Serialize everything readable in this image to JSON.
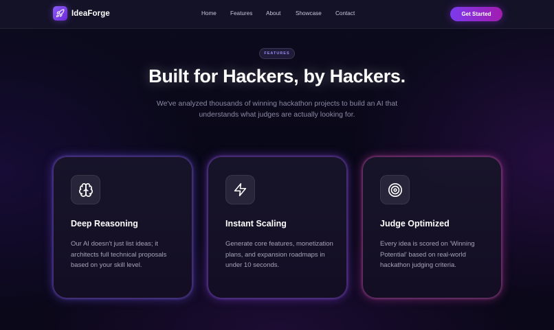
{
  "navbar": {
    "brand": "IdeaForge",
    "links": [
      "Home",
      "Features",
      "About",
      "Showcase",
      "Contact"
    ],
    "cta_label": "Get Started"
  },
  "hero": {
    "badge": "FEATURES",
    "title": "Built for Hackers, by Hackers.",
    "subtitle": "We've analyzed thousands of winning hackathon projects to build an AI that understands what judges are actually looking for."
  },
  "features": [
    {
      "icon": "brain-icon",
      "title": "Deep Reasoning",
      "description": "Our AI doesn't just list ideas; it architects full technical proposals based on your skill level."
    },
    {
      "icon": "lightning-icon",
      "title": "Instant Scaling",
      "description": "Generate core features, monetization plans, and expansion roadmaps in under 10 seconds."
    },
    {
      "icon": "target-icon",
      "title": "Judge Optimized",
      "description": "Every idea is scored on 'Winning Potential' based on real-world hackathon judging criteria."
    }
  ],
  "colors": {
    "accent_purple": "#7c3aed",
    "accent_magenta": "#a21caf",
    "background": "#0a0919",
    "badge_text": "#9b8cf7"
  }
}
